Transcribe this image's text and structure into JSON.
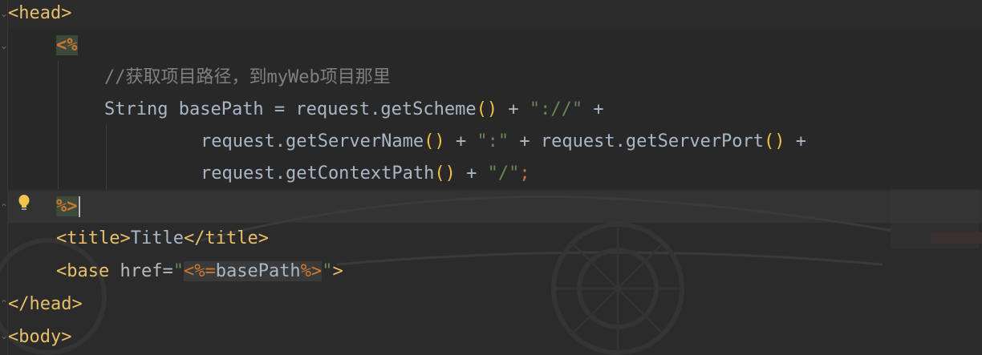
{
  "lines": {
    "head_open": "head",
    "jsp_open": "<%",
    "comment": "//获取项目路径，到myWeb项目那里",
    "l4": {
      "p1": "String basePath = request.getScheme",
      "paren1": "()",
      "p2": " + ",
      "s1": "\"://\"",
      "p3": " +"
    },
    "l5": {
      "p1": "request.getServerName",
      "paren1": "()",
      "p2": " + ",
      "s1": "\":\"",
      "p3": " + request.getServerPort",
      "paren2": "()",
      "p4": " +"
    },
    "l6": {
      "p1": "request.getContextPath",
      "paren1": "()",
      "p2": " + ",
      "s1": "\"/\"",
      "semi": ";"
    },
    "jsp_close": "%>",
    "title_open": "title",
    "title_text": "Title",
    "title_close": "/title",
    "base_tag": "base",
    "base_attr": "href",
    "base_eq": "=",
    "base_quote": "\"",
    "base_jsp_open": "<%=",
    "base_expr": "basePath",
    "base_jsp_close": "%>",
    "head_close": "/head",
    "body_open": "body"
  },
  "icons": {
    "intention": "lightbulb-icon",
    "fold": "fold-marker-icon"
  },
  "colors": {
    "background": "#2b2b2b",
    "tag": "#e8bf6a",
    "jsp_delim": "#cc7832",
    "comment": "#808080",
    "identifier": "#a9b7c6",
    "string": "#6a8759",
    "paren": "#f0c040"
  }
}
